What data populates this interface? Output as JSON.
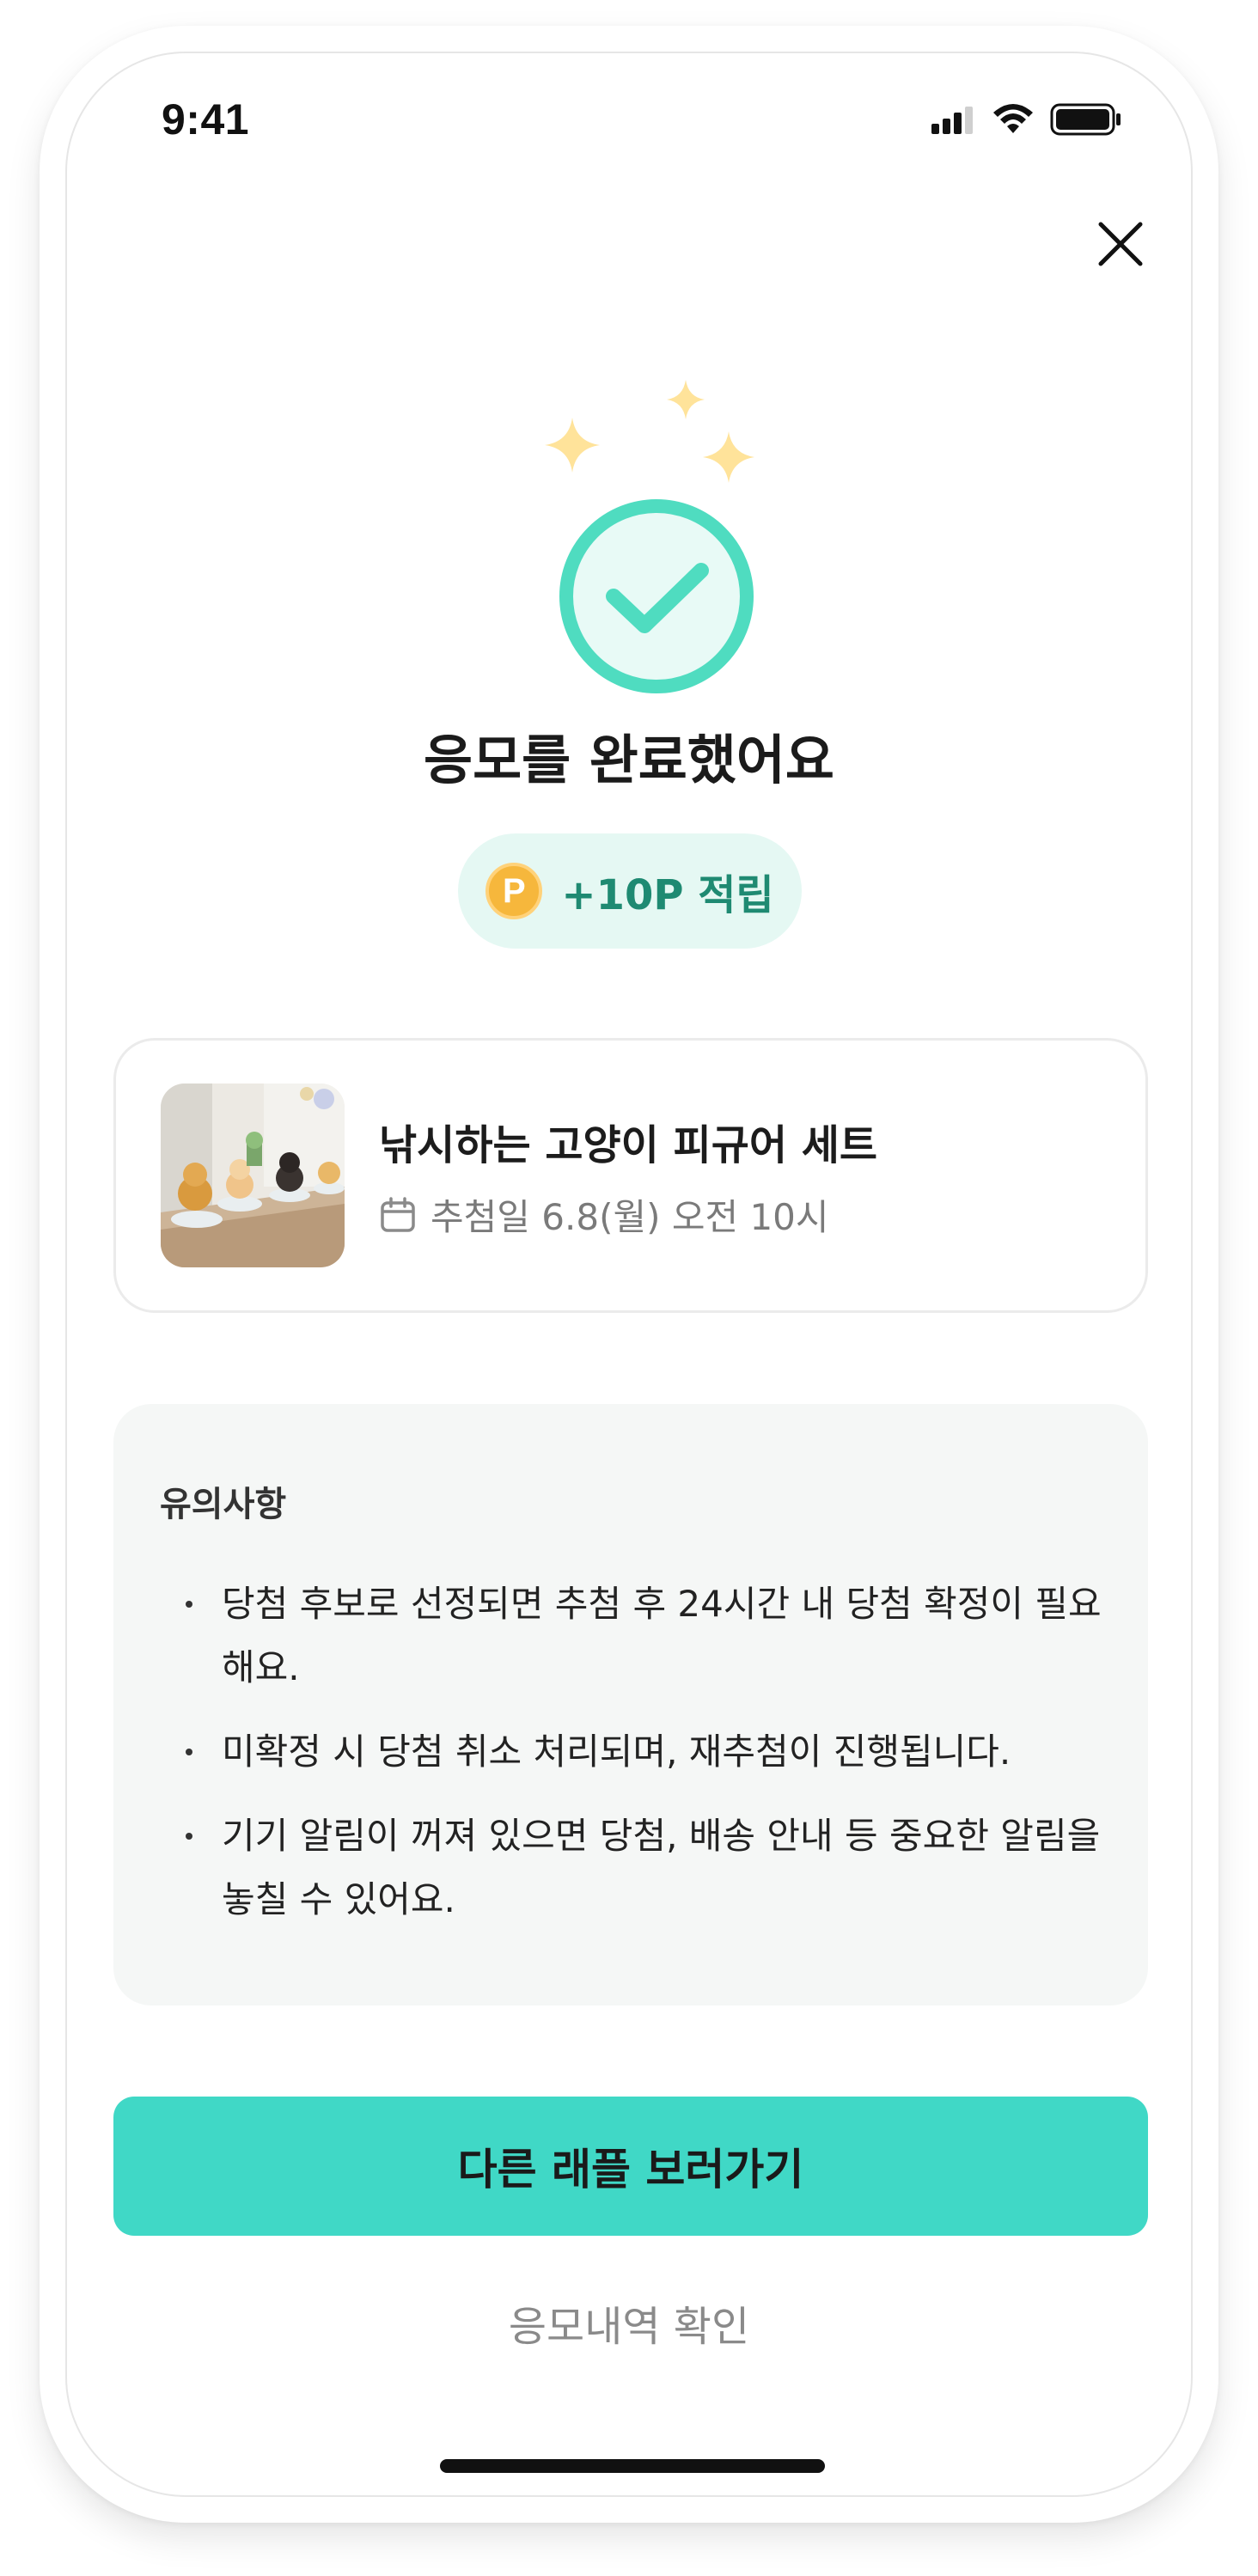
{
  "status_bar": {
    "time": "9:41"
  },
  "success": {
    "title": "응모를 완료했어요",
    "points_badge": {
      "coin_letter": "P",
      "text": "+10P 적립"
    }
  },
  "product": {
    "name": "낚시하는 고양이 피규어 세트",
    "draw_date": "추첨일 6.8(월) 오전 10시"
  },
  "notice": {
    "title": "유의사항",
    "items": [
      "당첨 후보로 선정되면 추첨 후 24시간 내 당첨 확정이 필요해요.",
      "미확정 시 당첨 취소 처리되며, 재추첨이 진행됩니다.",
      "기기 알림이 꺼져 있으면 당첨, 배송 안내 등 중요한 알림을 놓칠 수 있어요."
    ]
  },
  "actions": {
    "primary_label": "다른 래플 보러가기",
    "secondary_label": "응모내역 확인"
  },
  "colors": {
    "accent": "#40d8c6",
    "check_ring": "#4fdcc0",
    "points_bg": "#e5f8f3",
    "points_text": "#1f8a72",
    "sparkle": "#ffe39a",
    "coin": "#f6b73c"
  },
  "icons": [
    "close-icon",
    "check-circle-icon",
    "sparkle-icon",
    "calendar-icon",
    "signal-icon",
    "wifi-icon",
    "battery-icon"
  ]
}
